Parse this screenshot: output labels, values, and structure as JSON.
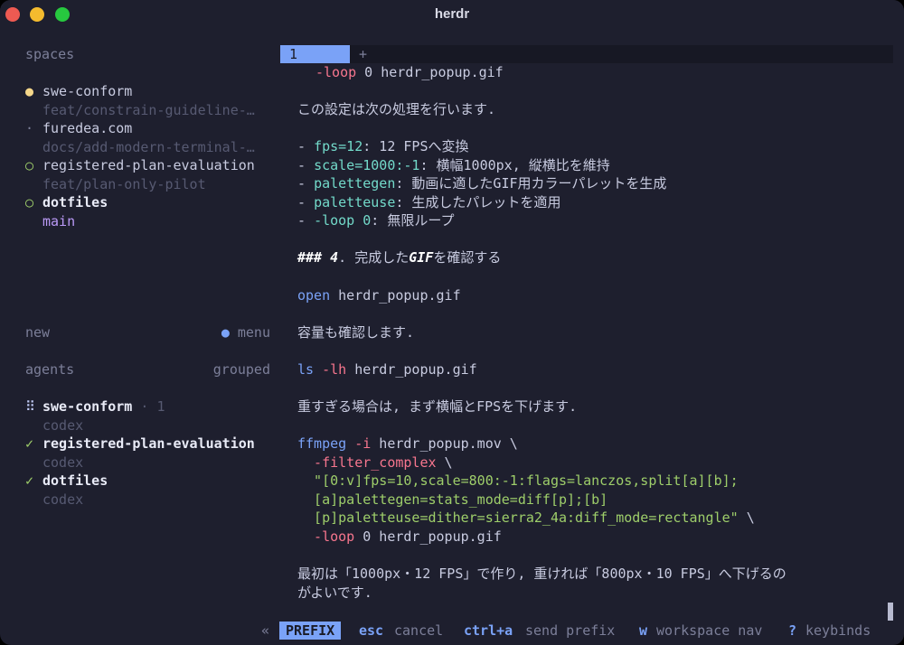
{
  "window": {
    "title": "herdr"
  },
  "sidebar": {
    "spaces_label": "spaces",
    "spaces": [
      {
        "name": "swe-conform",
        "branch": "feat/constrain-guideline-…",
        "marker": "●"
      },
      {
        "name": "furedea.com",
        "branch": "docs/add-modern-terminal-…",
        "marker": "·"
      },
      {
        "name": "registered-plan-evaluation",
        "branch": "feat/plan-only-pilot",
        "marker": "○"
      },
      {
        "name": "dotfiles",
        "branch": "main",
        "marker": "○"
      }
    ],
    "new_label": "new",
    "menu_dot": "●",
    "menu_label": "menu",
    "agents_label": "agents",
    "grouped_label": "grouped",
    "agents": [
      {
        "name": "swe-conform",
        "count_sep": "·",
        "count": "1",
        "sub": "codex",
        "marker": "⠿"
      },
      {
        "name": "registered-plan-evaluation",
        "sub": "codex",
        "marker": "✓"
      },
      {
        "name": "dotfiles",
        "sub": "codex",
        "marker": "✓"
      }
    ]
  },
  "tabs": {
    "active": "1",
    "add": "+"
  },
  "content": {
    "l01_flag": "-loop",
    "l01_rest": " 0 herdr_popup.gif",
    "l02": "この設定は次の処理を行います.",
    "l03_dash": "- ",
    "l03_code": "fps=12",
    "l03_rest": ": 12 FPSへ変換",
    "l04_dash": "- ",
    "l04_code": "scale=1000:-1",
    "l04_rest": ": 横幅1000px, 縦横比を維持",
    "l05_dash": "- ",
    "l05_code": "palettegen",
    "l05_rest": ": 動画に適したGIF用カラーパレットを生成",
    "l06_dash": "- ",
    "l06_code": "paletteuse",
    "l06_rest": ": 生成したパレットを適用",
    "l07_dash": "- ",
    "l07_code": "-loop 0",
    "l07_rest": ": 無限ループ",
    "l08_hash": "### 4",
    "l08_a": ". 完成した",
    "l08_b": "GIF",
    "l08_c": "を確認する",
    "l09_cmd": "open",
    "l09_rest": " herdr_popup.gif",
    "l10": "容量も確認します.",
    "l11_cmd": "ls",
    "l11_flag": " -lh",
    "l11_rest": " herdr_popup.gif",
    "l12": "重すぎる場合は, まず横幅とFPSを下げます.",
    "l13_cmd": "ffmpeg",
    "l13_flag": " -i",
    "l13_rest": " herdr_popup.mov \\",
    "l14_flag": "  -filter_complex",
    "l14_rest": " \\",
    "l15_str": "  \"[0:v]fps=10,scale=800:-1:flags=lanczos,split[a][b];",
    "l16_str": "  [a]palettegen=stats_mode=diff[p];[b]",
    "l17_str": "  [p]paletteuse=dither=sierra2_4a:diff_mode=rectangle\"",
    "l17_rest": " \\",
    "l18_flag": "  -loop",
    "l18_rest": " 0 herdr_popup.gif",
    "l19": "最初は「1000px・12 FPS」で作り, 重ければ「800px・10 FPS」へ下げるの",
    "l20": "がよいです."
  },
  "statusbar": {
    "collapse": "«",
    "prefix": "PREFIX",
    "esc_key": "esc",
    "esc_desc": "cancel",
    "ctrl_key": "ctrl+a",
    "ctrl_desc": "send prefix",
    "w_key": "w",
    "w_desc": "workspace nav",
    "help_key": "?",
    "help_desc": "keybinds"
  },
  "colors": {
    "background": "#1e1f2e",
    "accent": "#7aa2f7",
    "green": "#9ece6a",
    "purple": "#bb9af7",
    "muted": "#7c7f99"
  }
}
